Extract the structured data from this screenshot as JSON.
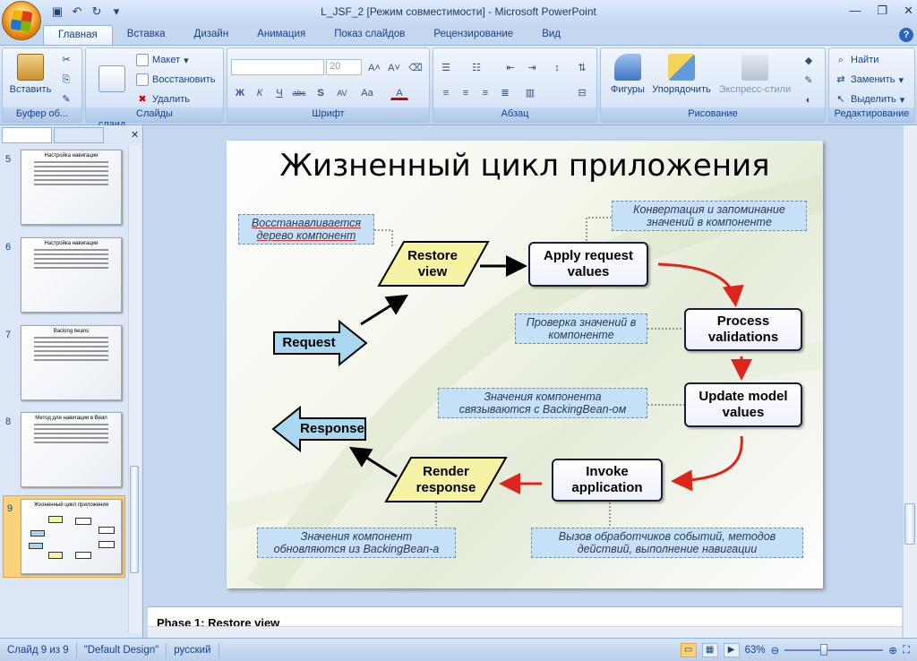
{
  "window": {
    "title": "L_JSF_2 [Режим совместимости] - Microsoft PowerPoint"
  },
  "ribbon": {
    "tabs": [
      "Главная",
      "Вставка",
      "Дизайн",
      "Анимация",
      "Показ слайдов",
      "Рецензирование",
      "Вид"
    ],
    "active_tab": "Главная",
    "groups": {
      "clipboard": {
        "label": "Буфер об...",
        "paste": "Вставить"
      },
      "slides": {
        "label": "Слайды",
        "new_slide": "Создать\nслайд",
        "layout": "Макет",
        "reset": "Восстановить",
        "delete": "Удалить"
      },
      "font": {
        "label": "Шрифт",
        "size": "20"
      },
      "paragraph": {
        "label": "Абзац"
      },
      "drawing": {
        "label": "Рисование",
        "shapes": "Фигуры",
        "arrange": "Упорядочить",
        "quick_styles": "Экспресс-стили"
      },
      "editing": {
        "label": "Редактирование",
        "find": "Найти",
        "replace": "Заменить",
        "select": "Выделить"
      }
    }
  },
  "slides_panel": {
    "thumbnails": [
      {
        "num": "5",
        "title": "Настройка навигации"
      },
      {
        "num": "6",
        "title": "Настройка навигации"
      },
      {
        "num": "7",
        "title": "Backing beans"
      },
      {
        "num": "8",
        "title": "Метод для навигации в Bean"
      },
      {
        "num": "9",
        "title": "Жизненный цикл приложения"
      }
    ],
    "selected": "9"
  },
  "slide": {
    "title": "Жизненный цикл приложения",
    "nodes": {
      "request": "Request",
      "restore_view": "Restore\nview",
      "apply_request": "Apply request\nvalues",
      "process_validations": "Process\nvalidations",
      "update_model": "Update model\nvalues",
      "invoke_application": "Invoke\napplication",
      "render_response": "Render\nresponse",
      "response": "Response"
    },
    "notes": {
      "restore": "Восстанавливается\nдерево компонент",
      "convert": "Конвертация и запоминание\nзначений в компоненте",
      "check": "Проверка значений в\nкомпоненте",
      "bind": "Значения компонента\nсвязываются с BackingBean-ом",
      "update": "Значения компонент\nобновляются из BackingBean-а",
      "invoke": "Вызов обработчиков событий, методов\nдействий, выполнение навигации"
    }
  },
  "notes_pane": {
    "text": "Phase 1: Restore view"
  },
  "status": {
    "slide": "Слайд 9 из 9",
    "design": "\"Default Design\"",
    "language": "русский",
    "zoom": "63%"
  },
  "colors": {
    "accent": "#15428b",
    "arrow_red": "#e0241c",
    "note_bg": "#c6e0f7",
    "request_fill": "#a8d8f0",
    "parallelogram_fill": "#f7f3a4"
  }
}
